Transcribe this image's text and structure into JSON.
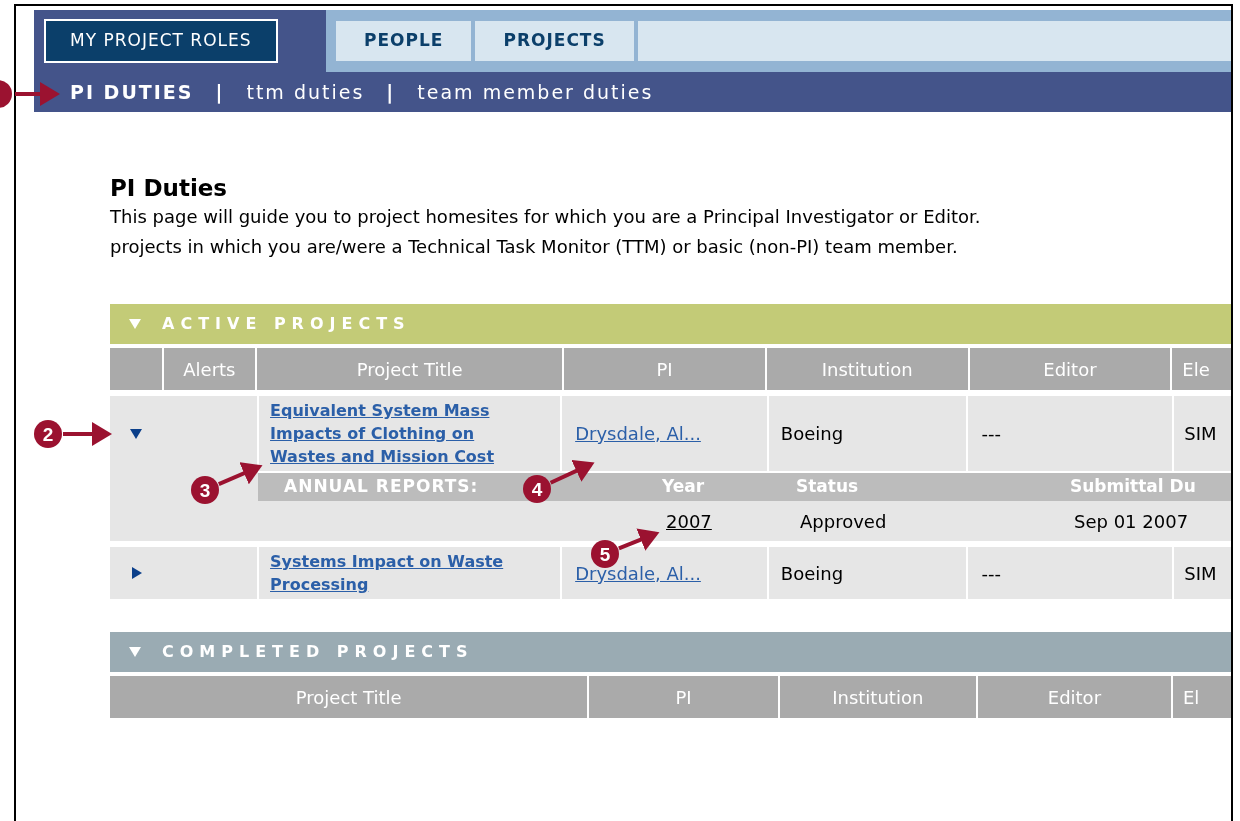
{
  "nav": {
    "tabs": [
      {
        "label": "MY PROJECT ROLES",
        "selected": true
      },
      {
        "label": "PEOPLE",
        "selected": false
      },
      {
        "label": "PROJECTS",
        "selected": false
      }
    ],
    "subnav": [
      {
        "label": "PI DUTIES",
        "selected": true
      },
      {
        "label": "ttm duties",
        "selected": false
      },
      {
        "label": "team member duties",
        "selected": false
      }
    ],
    "separators": [
      "|",
      "|"
    ]
  },
  "page": {
    "title": "PI Duties",
    "description": [
      "This page will guide you to project homesites for which you are a Principal Investigator or Editor.",
      "projects in which you are/were a Technical Task Monitor (TTM) or basic (non-PI) team member."
    ]
  },
  "active_projects": {
    "title": "ACTIVE PROJECTS",
    "expanded": true,
    "columns": [
      "Alerts",
      "Project Title",
      "PI",
      "Institution",
      "Editor",
      "Ele"
    ],
    "rows": [
      {
        "expanded": true,
        "title": "Equivalent System Mass Impacts of Clothing on Wastes and Mission Cost",
        "pi": "Drysdale, Al...",
        "institution": "Boeing",
        "editor": "---",
        "column_7": "SIM",
        "annual_reports": {
          "label": "ANNUAL REPORTS:",
          "columns": [
            "Year",
            "Status",
            "Submittal Du"
          ],
          "rows": [
            {
              "year": "2007",
              "status": "Approved",
              "due": "Sep 01 2007"
            }
          ]
        }
      },
      {
        "expanded": false,
        "title": "Systems Impact on Waste Processing",
        "pi": "Drysdale, Al...",
        "institution": "Boeing",
        "editor": "---",
        "column_7": "SIM"
      }
    ]
  },
  "completed_projects": {
    "title": "COMPLETED PROJECTS",
    "expanded": true,
    "columns": [
      "Project Title",
      "PI",
      "Institution",
      "Editor",
      "El"
    ]
  },
  "callouts": [
    {
      "cut_off": true
    },
    {
      "number": "2"
    },
    {
      "number": "3"
    },
    {
      "number": "4"
    },
    {
      "number": "5"
    }
  ]
}
